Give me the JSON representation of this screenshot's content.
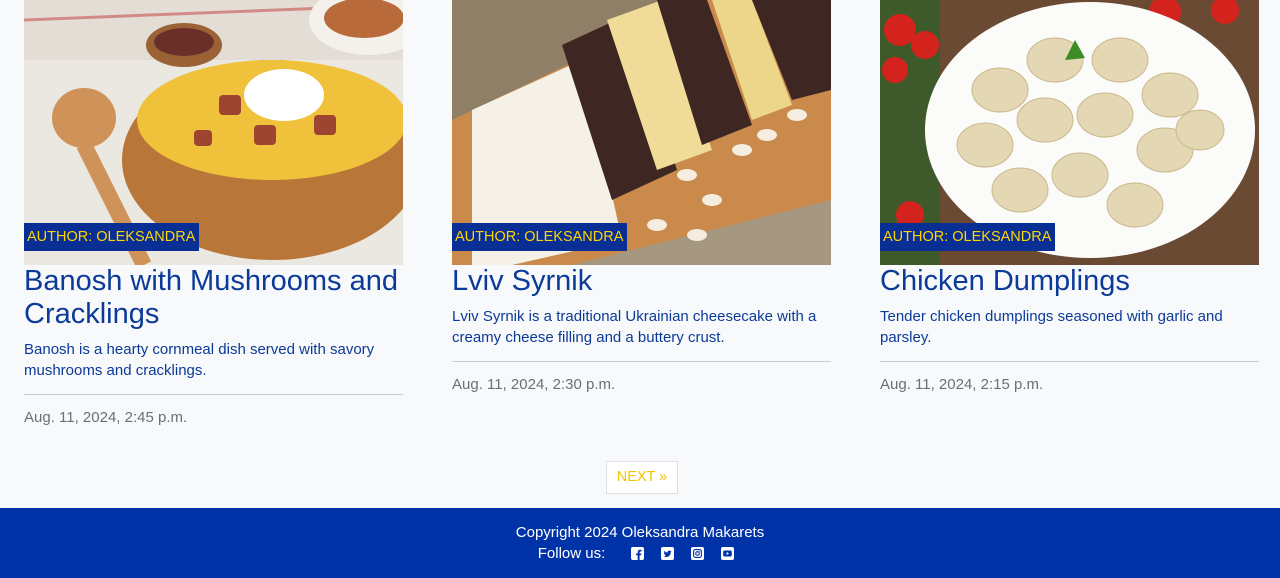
{
  "cards": [
    {
      "author": "AUTHOR: OLEKSANDRA",
      "title": "Banosh with Mushrooms and Cracklings",
      "description": "Banosh is a hearty cornmeal dish served with savory mushrooms and cracklings.",
      "date": "Aug. 11, 2024, 2:45 p.m.",
      "image": "banosh-photo"
    },
    {
      "author": "AUTHOR: OLEKSANDRA",
      "title": "Lviv Syrnik",
      "description": "Lviv Syrnik is a traditional Ukrainian cheesecake with a creamy cheese filling and a buttery crust.",
      "date": "Aug. 11, 2024, 2:30 p.m.",
      "image": "syrnik-photo"
    },
    {
      "author": "AUTHOR: OLEKSANDRA",
      "title": "Chicken Dumplings",
      "description": "Tender chicken dumplings seasoned with garlic and parsley.",
      "date": "Aug. 11, 2024, 2:15 p.m.",
      "image": "dumplings-photo"
    }
  ],
  "pagination": {
    "next_label": "NEXT »"
  },
  "footer": {
    "copyright": "Copyright 2024 Oleksandra Makarets",
    "follow_label": "Follow us:",
    "social": [
      "facebook-icon",
      "twitter-icon",
      "instagram-icon",
      "youtube-icon"
    ]
  },
  "colors": {
    "brand_blue": "#0033a8",
    "badge_bg": "#0a2f94",
    "accent_yellow": "#ffd500",
    "title_blue": "#0b3a99"
  }
}
